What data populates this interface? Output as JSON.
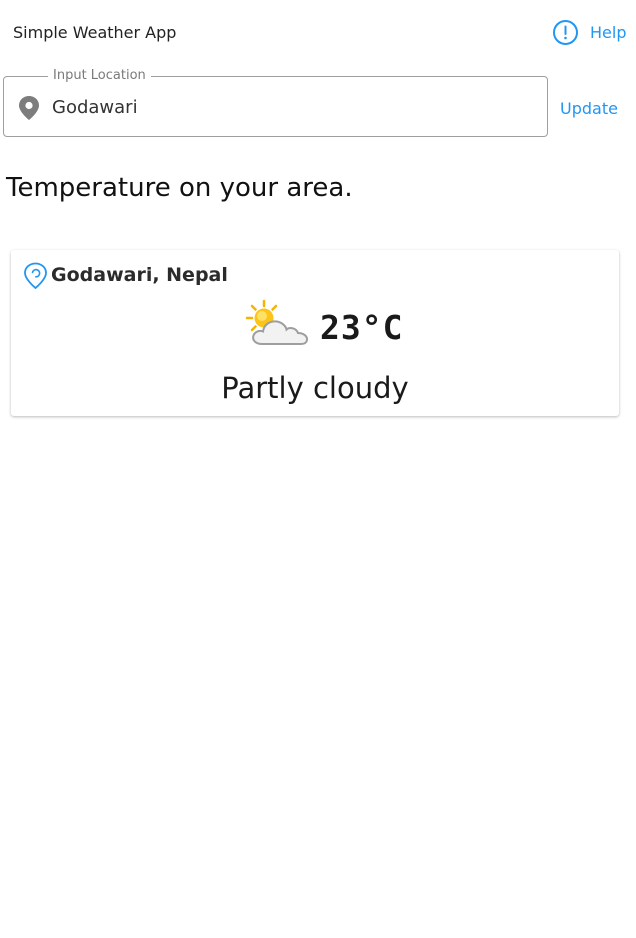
{
  "app": {
    "title": "Simple Weather App"
  },
  "header": {
    "help_label": "Help",
    "help_icon": "alert-circle-icon",
    "accent_color": "#2196f3"
  },
  "search": {
    "legend": "Input Location",
    "value": "Godawari",
    "icon": "map-pin-icon",
    "update_label": "Update"
  },
  "main": {
    "heading": "Temperature on your area."
  },
  "weather": {
    "location_icon": "location-marker-icon",
    "location": "Godawari, Nepal",
    "condition_icon": "partly-cloudy-icon",
    "temperature": "23°C",
    "condition": "Partly cloudy"
  }
}
